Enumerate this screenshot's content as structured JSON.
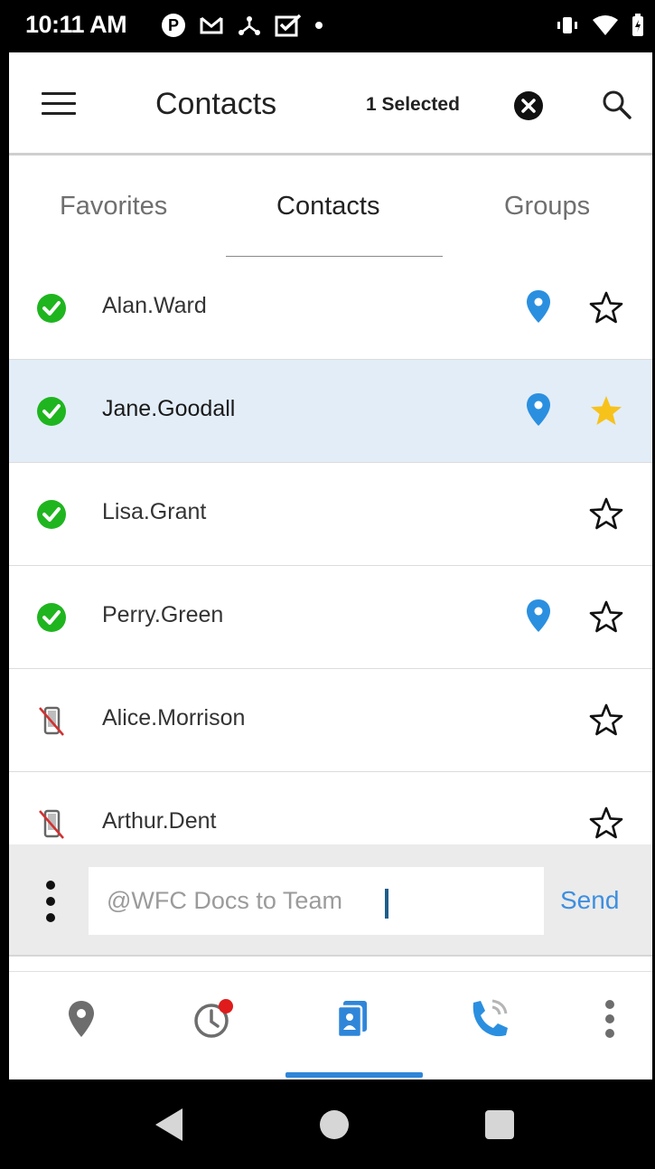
{
  "status_bar": {
    "time": "10:11 AM",
    "left_icons": [
      "parking-icon",
      "mail-icon",
      "network-icon",
      "checkbox-icon",
      "dot-icon"
    ],
    "right_icons": [
      "vibrate-icon",
      "wifi-icon",
      "battery-icon"
    ]
  },
  "header": {
    "title": "Contacts",
    "selection_count": "1 Selected",
    "icons": {
      "menu": "hamburger-icon",
      "clear": "close-circle-icon",
      "search": "search-icon"
    }
  },
  "tabs": [
    {
      "label": "Favorites",
      "active": false
    },
    {
      "label": "Contacts",
      "active": true
    },
    {
      "label": "Groups",
      "active": false
    }
  ],
  "contacts": [
    {
      "name": "Alan.Ward",
      "status": "available",
      "has_location": true,
      "favorite": false,
      "selected": false
    },
    {
      "name": "Jane.Goodall",
      "status": "available",
      "has_location": true,
      "favorite": true,
      "selected": true
    },
    {
      "name": "Lisa.Grant",
      "status": "available",
      "has_location": false,
      "favorite": false,
      "selected": false
    },
    {
      "name": "Perry.Green",
      "status": "available",
      "has_location": true,
      "favorite": false,
      "selected": false
    },
    {
      "name": "Alice.Morrison",
      "status": "offline",
      "has_location": false,
      "favorite": false,
      "selected": false
    },
    {
      "name": "Arthur.Dent",
      "status": "offline",
      "has_location": false,
      "favorite": false,
      "selected": false
    }
  ],
  "compose": {
    "placeholder": "@WFC Docs to Team",
    "send_label": "Send"
  },
  "bottom_nav": {
    "items": [
      "location-icon",
      "history-icon",
      "contacts-icon",
      "call-icon",
      "more-vertical-icon"
    ],
    "active_index": 2,
    "history_has_badge": true
  },
  "colors": {
    "available": "#1fb51f",
    "location_pin": "#2b8fe0",
    "favorite_star": "#f7c21a",
    "selected_row_bg": "#e3edf8",
    "accent": "#2f86d9",
    "badge": "#e01b1b",
    "offline_slash": "#d32f2f"
  }
}
